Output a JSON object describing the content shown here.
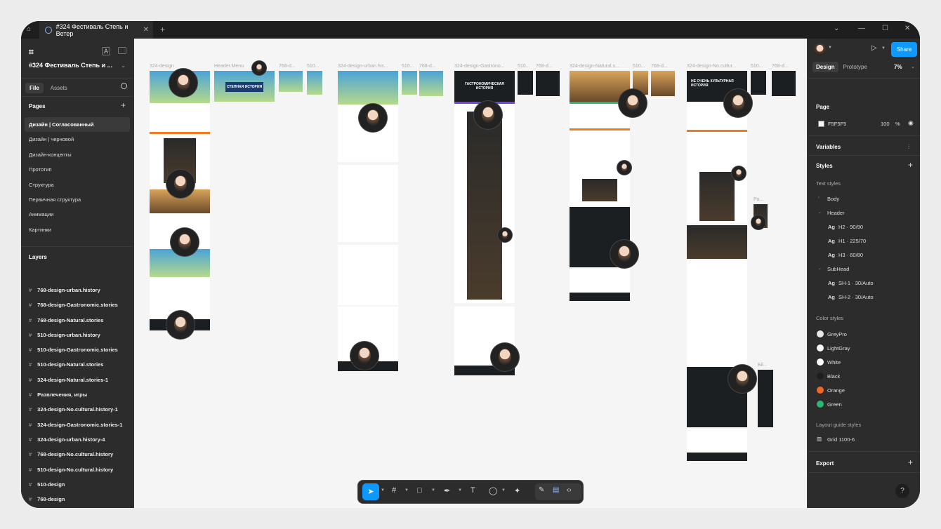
{
  "tab": {
    "title": "#324 Фестиваль Степь и Ветер",
    "close": "✕",
    "new": "+"
  },
  "window": {
    "chevron": "⌄",
    "minimize": "—",
    "maximize": "☐",
    "close": "✕"
  },
  "left": {
    "logo": "⌗",
    "project_title": "#324 Фестиваль Степь и ...",
    "lang_badge": "A",
    "file_tabs": [
      "File",
      "Assets"
    ],
    "pages_title": "Pages",
    "pages": [
      "Дизайн | Согласованный",
      "Дизайн | черновой",
      "Дизайн-концепты",
      "Прототип",
      "Структура",
      "Первичная структура",
      "Анимации",
      "Картинки"
    ],
    "layers_title": "Layers",
    "layers": [
      "768-design-urban.history",
      "768-design-Gastronomic.stories",
      "768-design-Natural.stories",
      "510-design-urban.history",
      "510-design-Gastronomic.stories",
      "510-design-Natural.stories",
      "324-design-Natural.stories-1",
      "Развлечения, игры",
      "324-design-No.cultural.history-1",
      "324-design-Gastronomic.stories-1",
      "324-design-urban.history-4",
      "768-design-No.cultural.history",
      "510-design-No.cultural.history",
      "510-design",
      "768-design",
      "324-design-1"
    ]
  },
  "canvas": {
    "labels": [
      "324-design",
      "Header.Menu",
      "768-d...",
      "510...",
      "324-design-urban.his...",
      "510...",
      "768-d...",
      "324-design-Gastrono...",
      "510...",
      "768-d...",
      "324-design-Natural.s...",
      "510...",
      "768-d...",
      "324-design-No.cultur...",
      "510...",
      "768-d...",
      "Ра...",
      "Бil..."
    ],
    "hero_texts": [
      "СТЕПНАЯ ИСТОРИЯ",
      "ГАСТРОНОМИЧЕСКАЯ ИСТОРИЯ",
      "НЕ ОЧЕНЬ КУЛЬТУРНАЯ ИСТОРИЯ"
    ]
  },
  "right": {
    "share": "Share",
    "mode_tabs": [
      "Design",
      "Prototype"
    ],
    "zoom": "7%",
    "page_section": "Page",
    "page_color": "F5F5F5",
    "page_opacity": "100",
    "percent": "%",
    "variables": "Variables",
    "styles": "Styles",
    "text_styles_label": "Text styles",
    "text_groups": [
      "Body",
      "Header"
    ],
    "header_styles": [
      "H2 · 90/90",
      "H1 · 225/70",
      "H3 · 60/80"
    ],
    "subhead_group": "SubHead",
    "subhead_styles": [
      "SH-1 · 30/Auto",
      "SH-2 · 30/Auto"
    ],
    "color_styles_label": "Color styles",
    "colors": [
      {
        "name": "GreyPro",
        "hex": "#e8e8e8"
      },
      {
        "name": "LightGray",
        "hex": "#f5f5f5"
      },
      {
        "name": "White",
        "hex": "#ffffff"
      },
      {
        "name": "Black",
        "hex": "#1e1e1e"
      },
      {
        "name": "Orange",
        "hex": "#f26522"
      },
      {
        "name": "Green",
        "hex": "#2bb673"
      }
    ],
    "layout_guide_label": "Layout guide styles",
    "grid_style": "Grid 1100-6",
    "export": "Export",
    "help": "?"
  },
  "toolbar": {
    "tools": [
      "move-tool",
      "frame-tool",
      "shape-tool",
      "pen-tool",
      "text-tool",
      "comment-tool",
      "actions-tool",
      "draw-mode",
      "design-mode",
      "dev-mode"
    ]
  }
}
